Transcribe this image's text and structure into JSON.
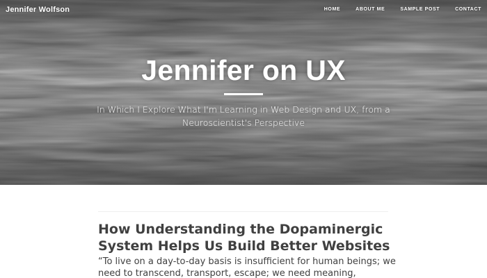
{
  "header": {
    "brand": "Jennifer Wolfson",
    "nav": [
      {
        "label": "Home"
      },
      {
        "label": "About Me"
      },
      {
        "label": "Sample Post"
      },
      {
        "label": "Contact"
      }
    ],
    "title": "Jennifer on UX",
    "subtitle": "In Which I Explore What I'm Learning in Web Design and UX, from a Neuroscientist's Perspective",
    "background_image": "ocean-water-surface"
  },
  "posts": [
    {
      "title": "How Understanding the Dopaminergic System Helps Us Build Better Websites",
      "excerpt": "“To live on a day-to-day basis is insufficient for human beings; we need to transcend, transport, escape; we need meaning,"
    }
  ],
  "colors": {
    "text": "#404040",
    "header_text": "#ffffff",
    "divider": "#eeeeee"
  }
}
